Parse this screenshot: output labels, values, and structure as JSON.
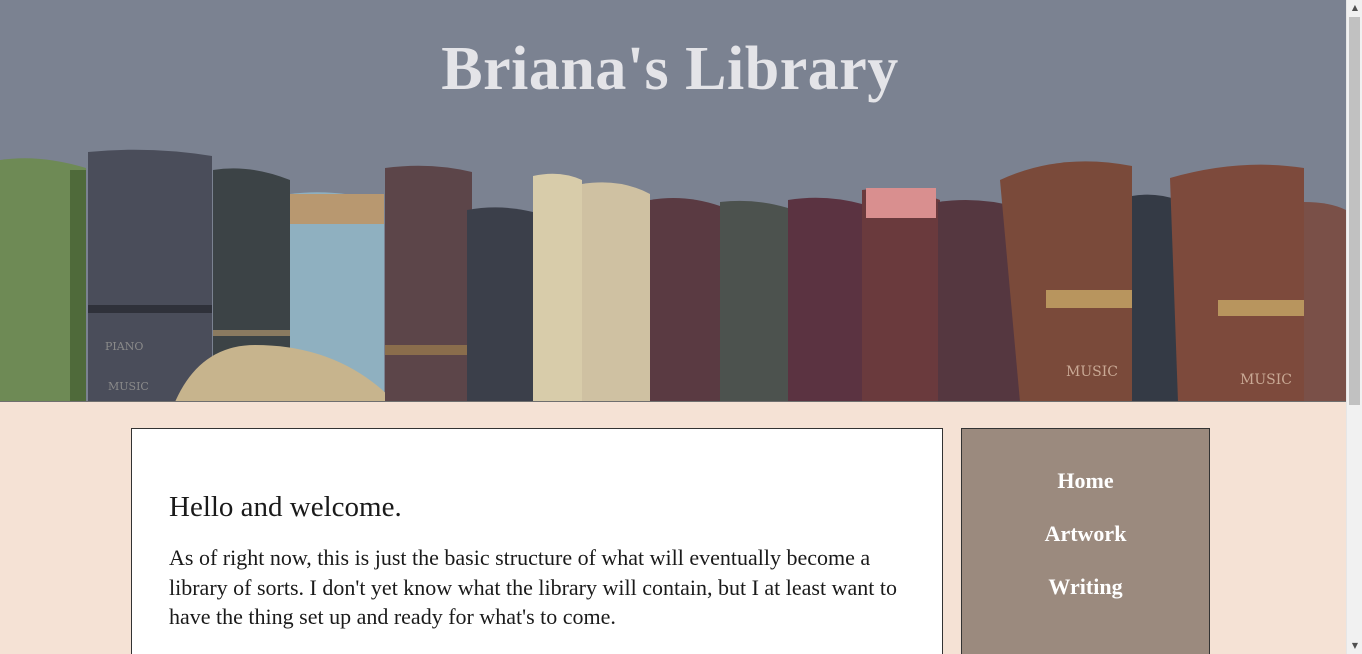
{
  "site": {
    "title": "Briana's Library"
  },
  "header": {
    "banner_image": "antique-books-on-shelf",
    "book_spine_labels": [
      "PIANO",
      "MUSIC",
      "MUSIC",
      "MUSIC"
    ]
  },
  "main": {
    "heading": "Hello and welcome.",
    "paragraph": "As of right now, this is just the basic structure of what will eventually become a library of sorts. I don't yet know what the library will contain, but I at least want to have the thing set up and ready for what's to come."
  },
  "nav": {
    "items": [
      {
        "label": "Home"
      },
      {
        "label": "Artwork"
      },
      {
        "label": "Writing"
      }
    ]
  },
  "colors": {
    "header_bg": "#7b8291",
    "page_bg": "#f5e2d5",
    "nav_bg": "#9b8a7e",
    "title_text": "#e4e4e8"
  }
}
